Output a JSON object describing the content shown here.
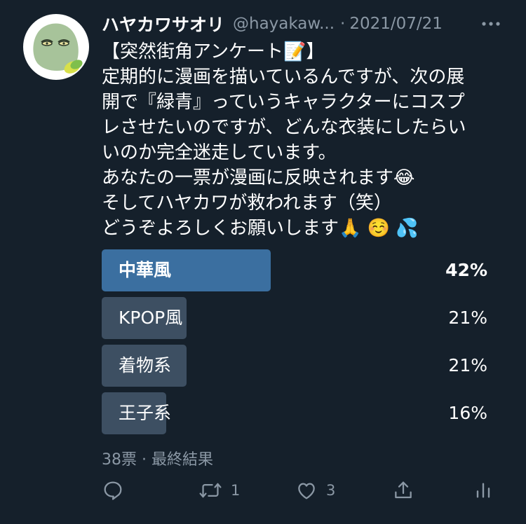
{
  "tweet": {
    "display_name": "ハヤカワサオリ",
    "handle": "@hayakaw...",
    "separator": "·",
    "date": "2021/07/21",
    "lines": [
      "【突然街角アンケート📝】",
      "定期的に漫画を描いているんですが、次の展",
      "開で『緑青』っていうキャラクターにコスプ",
      "レさせたいのですが、どんな衣装にしたらい",
      "いのか完全迷走しています。",
      "あなたの一票が漫画に反映されます😂",
      "そしてハヤカワが救われます（笑）",
      "どうぞよろしくお願いします🙏 ☺️ 💦"
    ]
  },
  "poll": {
    "choices": [
      {
        "label": "中華風",
        "percent_text": "42%",
        "percent": 42,
        "winner": true
      },
      {
        "label": "KPOP風",
        "percent_text": "21%",
        "percent": 21,
        "winner": false
      },
      {
        "label": "着物系",
        "percent_text": "21%",
        "percent": 21,
        "winner": false
      },
      {
        "label": "王子系",
        "percent_text": "16%",
        "percent": 16,
        "winner": false
      }
    ],
    "meta": "38票 · 最終結果"
  },
  "actions": {
    "reply_count": "",
    "retweet_count": "1",
    "like_count": "3"
  },
  "icons": {
    "reply": "reply-icon",
    "retweet": "retweet-icon",
    "like": "heart-icon",
    "share": "share-icon",
    "analytics": "analytics-icon",
    "more": "more-icon"
  },
  "colors": {
    "background": "#15202b",
    "winner_bar": "#3b6fa0",
    "bar": "#3d4f62",
    "secondary_text": "#8b98a5"
  }
}
